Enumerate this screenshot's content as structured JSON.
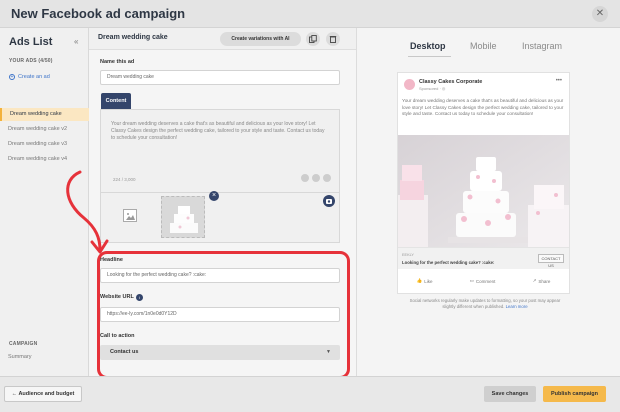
{
  "window": {
    "title": "New Facebook ad campaign"
  },
  "sidebar": {
    "title": "Ads List",
    "section_label": "YOUR ADS (4/50)",
    "create_label": "Create an ad",
    "items": [
      {
        "label": "Dream wedding cake"
      },
      {
        "label": "Dream wedding cake v2"
      },
      {
        "label": "Dream wedding cake v3"
      },
      {
        "label": "Dream wedding cake v4"
      }
    ],
    "campaign_label": "CAMPAIGN",
    "summary_label": "Summary"
  },
  "editor": {
    "ad_title": "Dream wedding cake",
    "variations_label": "Create variations with AI",
    "name_label": "Name this ad",
    "name_value": "Dream wedding cake",
    "content_tab": "Content",
    "content_text": "Your dream wedding deserves a cake that's as beautiful and delicious as your love story! Let Classy Cakes design the perfect wedding cake, tailored to your style and taste. Contact us today to schedule your consultation!",
    "char_count": "224 / 3,000",
    "headline_label": "Headline",
    "headline_value": "Looking for the perfect wedding cake? :cake:",
    "url_label": "Website URL",
    "url_value": "https://ee-ly.com/1n0e0d0Y12D",
    "cta_label": "Call to action",
    "cta_value": "Contact us"
  },
  "preview": {
    "tabs": [
      {
        "label": "Desktop"
      },
      {
        "label": "Mobile"
      },
      {
        "label": "Instagram"
      }
    ],
    "page_name": "Classy Cakes Corporate",
    "sponsored": "Sponsored · ◎",
    "post_text": "Your dream wedding deserves a cake that's as beautiful and delicious as your love story! Let Classy Cakes design the perfect wedding cake, tailored to your style and taste. Contact us today to schedule your consultation!",
    "domain": "EEKLY",
    "headline": "Looking for the perfect wedding cake? :cake:",
    "cta_button": "CONTACT US",
    "actions": {
      "like": "Like",
      "comment": "Comment",
      "share": "Share"
    },
    "note_text": "Social networks regularly make updates to formatting, so your post may appear slightly different when published.",
    "note_link": "Learn more"
  },
  "footer": {
    "back_label": "← Audience and budget",
    "save_label": "Save changes",
    "publish_label": "Publish campaign"
  },
  "colors": {
    "accent_navy": "#34456b",
    "highlight_red": "#e6323a",
    "publish_orange": "#f5b94b",
    "active_item_bg": "#fbe7c2"
  }
}
